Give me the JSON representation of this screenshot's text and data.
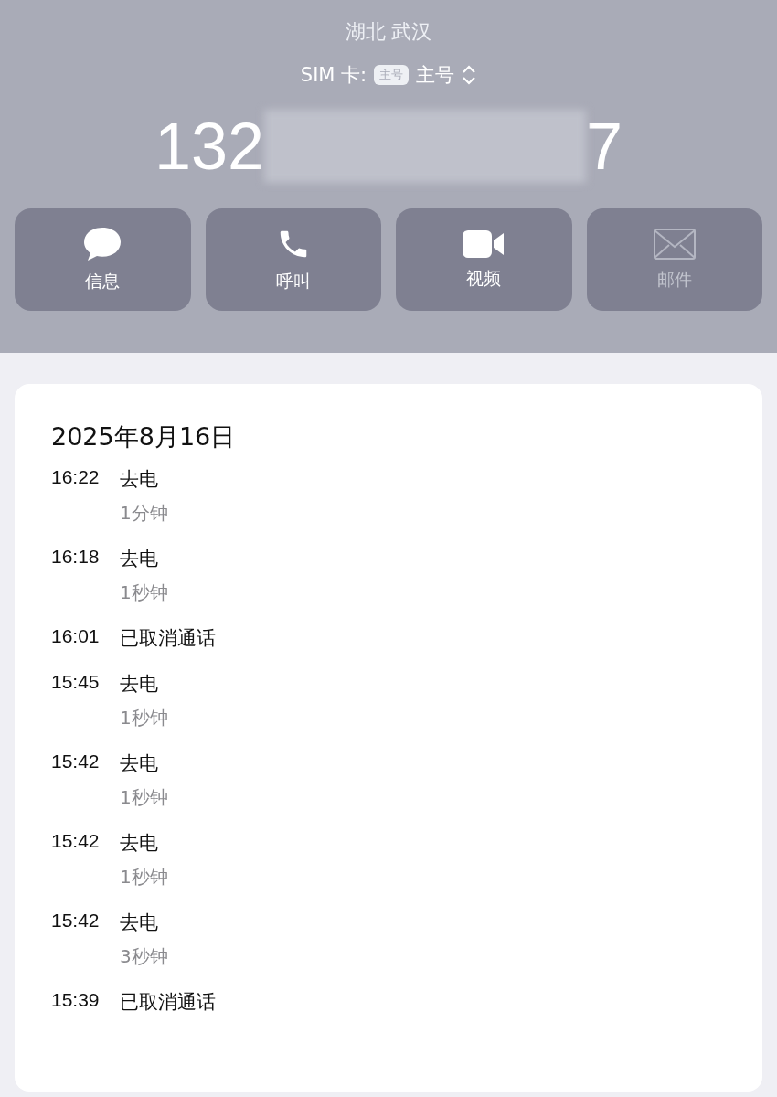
{
  "header": {
    "location": "湖北 武汉",
    "sim": {
      "label": "SIM 卡:",
      "badge": "主号",
      "value": "主号"
    },
    "number": {
      "prefix": "132",
      "redacted": true,
      "suffix": "7"
    }
  },
  "actions": [
    {
      "kind": "message",
      "label": "信息",
      "disabled": false
    },
    {
      "kind": "phone",
      "label": "呼叫",
      "disabled": false
    },
    {
      "kind": "video",
      "label": "视频",
      "disabled": false
    },
    {
      "kind": "mail",
      "label": "邮件",
      "disabled": true
    }
  ],
  "history": {
    "date": "2025年8月16日",
    "calls": [
      {
        "time": "16:22",
        "type": "去电",
        "duration": "1分钟"
      },
      {
        "time": "16:18",
        "type": "去电",
        "duration": "1秒钟"
      },
      {
        "time": "16:01",
        "type": "已取消通话"
      },
      {
        "time": "15:45",
        "type": "去电",
        "duration": "1秒钟"
      },
      {
        "time": "15:42",
        "type": "去电",
        "duration": "1秒钟"
      },
      {
        "time": "15:42",
        "type": "去电",
        "duration": "1秒钟"
      },
      {
        "time": "15:42",
        "type": "去电",
        "duration": "3秒钟"
      },
      {
        "time": "15:39",
        "type": "已取消通话"
      }
    ]
  }
}
